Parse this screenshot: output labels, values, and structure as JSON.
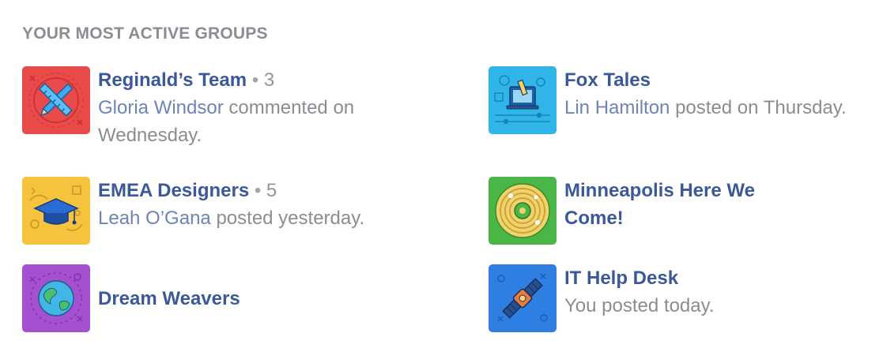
{
  "heading": "YOUR MOST ACTIVE GROUPS",
  "separator": " • ",
  "groups": [
    {
      "name": "Reginald’s Team",
      "count": "3",
      "person": "Gloria Windsor",
      "activity": " commented on Wednesday.",
      "icon": "pencil-ruler-icon",
      "color": "#e94b4b"
    },
    {
      "name": "Fox Tales",
      "count": "",
      "person": "Lin Hamilton",
      "activity": " posted on Thursday.",
      "icon": "laptop-icon",
      "color": "#2fb5e8"
    },
    {
      "name": "EMEA Designers",
      "count": "5",
      "person": "Leah O’Gana",
      "activity": " posted yesterday.",
      "icon": "graduation-cap-icon",
      "color": "#f6c43c"
    },
    {
      "name": "Minneapolis Here We Come!",
      "count": "",
      "person": "",
      "activity": "",
      "icon": "target-map-icon",
      "color": "#4bb648"
    },
    {
      "name": "Dream Weavers",
      "count": "",
      "person": "",
      "activity": "",
      "icon": "globe-icon",
      "color": "#a54fd1"
    },
    {
      "name": "IT Help Desk",
      "count": "",
      "person": "",
      "activity": "You posted today.",
      "icon": "satellite-icon",
      "color": "#2f7fe3"
    }
  ]
}
